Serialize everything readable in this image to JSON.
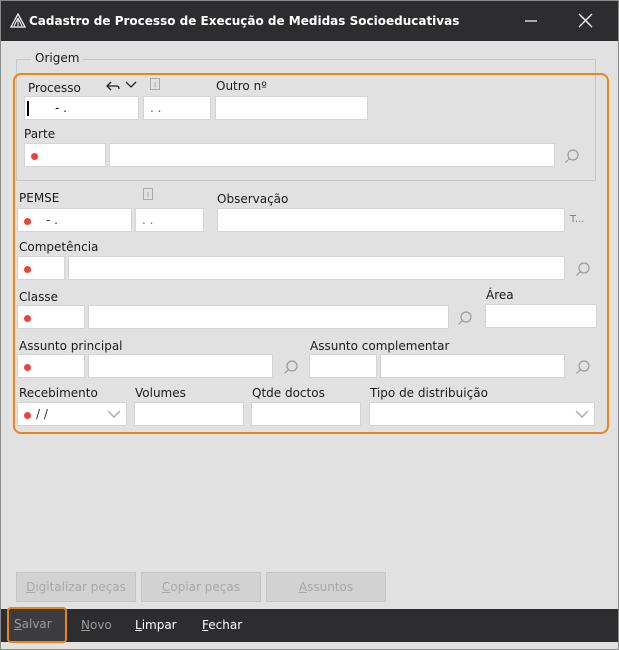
{
  "window": {
    "title": "Cadastro de Processo de Execução de Medidas Socioeducativas"
  },
  "origem": {
    "group_title": "Origem",
    "processo_label": "Processo",
    "processo_value": "-  .",
    "processo_suffix": ". .",
    "outro_label": "Outro nº",
    "parte_label": "Parte"
  },
  "pemse": {
    "label": "PEMSE",
    "value": "-  .",
    "suffix": ". .",
    "observacao_label": "Observação",
    "observacao_more": "T..."
  },
  "competencia": {
    "label": "Competência"
  },
  "classe": {
    "label": "Classe",
    "area_label": "Área"
  },
  "assunto": {
    "principal_label": "Assunto principal",
    "complementar_label": "Assunto complementar"
  },
  "row_last": {
    "recebimento_label": "Recebimento",
    "recebimento_value": "/ /",
    "volumes_label": "Volumes",
    "qtde_label": "Qtde doctos",
    "tipo_label": "Tipo de distribuição"
  },
  "actions": {
    "digitalizar_pre": "D",
    "digitalizar_rest": "igitalizar peças",
    "copiar_pre": "C",
    "copiar_rest": "opiar peças",
    "assuntos_pre": "A",
    "assuntos_rest": "ssuntos"
  },
  "footer": {
    "salvar_pre": "S",
    "salvar_rest": "alvar",
    "novo_pre": "N",
    "novo_rest": "ovo",
    "limpar_pre": "L",
    "limpar_rest": "impar",
    "fechar_pre": "F",
    "fechar_rest": "echar"
  },
  "colors": {
    "accent": "#e8861d",
    "required": "#e8443a",
    "titlebar": "#2d2d30"
  }
}
